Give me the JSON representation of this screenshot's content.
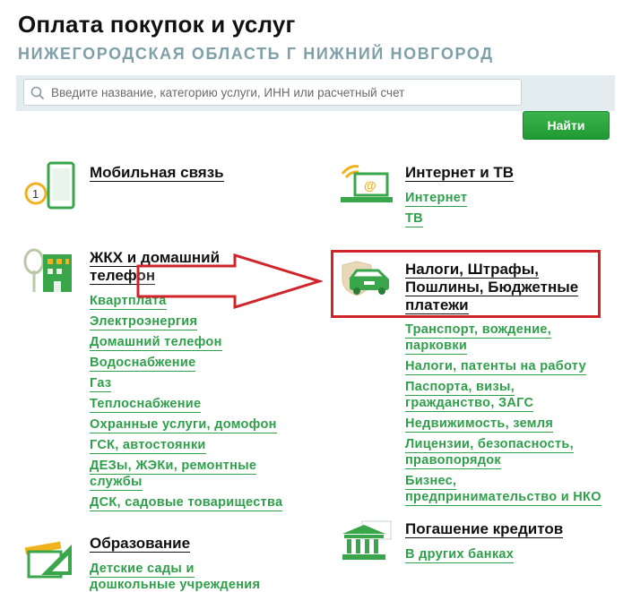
{
  "page": {
    "title": "Оплата покупок и услуг",
    "region": "НИЖЕГОРОДСКАЯ ОБЛАСТЬ Г НИЖНИЙ НОВГОРОД"
  },
  "search": {
    "placeholder": "Введите название, категорию услуги, ИНН или расчетный счет",
    "button_label": "Найти"
  },
  "categories": {
    "mobile": {
      "title": "Мобильная связь",
      "icon": "mobile-phone-icon"
    },
    "internet": {
      "title": "Интернет и ТВ",
      "icon": "laptop-icon",
      "links": [
        "Интернет",
        "ТВ"
      ]
    },
    "zhkh": {
      "title_line1": "ЖКХ и домашний",
      "title_line2": "телефон",
      "icon": "building-icon",
      "links": [
        "Квартплата",
        "Электроэнергия",
        "Домашний телефон",
        "Водоснабжение",
        "Газ",
        "Теплоснабжение",
        "Охранные услуги, домофон",
        "ГСК, автостоянки"
      ],
      "link_deza_line1": "ДЕЗы, ЖЭКи, ремонтные",
      "link_deza_line2": "службы",
      "link_dsk": "ДСК, садовые товарищества"
    },
    "taxes": {
      "title_line1": "Налоги, Штрафы,",
      "title_line2": "Пошлины, Бюджетные",
      "title_line3": "платежи",
      "icon": "car-shield-icon",
      "links": [
        [
          "Транспорт, вождение,",
          "парковки"
        ],
        [
          "Налоги, патенты на работу"
        ],
        [
          "Паспорта, визы,",
          "гражданство, ЗАГС"
        ],
        [
          "Недвижимость, земля"
        ],
        [
          "Лицензии, безопасность,",
          "правопорядок"
        ],
        [
          "Бизнес,",
          "предпринимательство и НКО"
        ]
      ]
    },
    "education": {
      "title": "Образование",
      "icon": "ruler-triangle-icon",
      "link_line1": "Детские сады и",
      "link_line2": "дошкольные учреждения"
    },
    "credits": {
      "title": "Погашение кредитов",
      "icon": "bank-icon",
      "links": [
        "В других банках"
      ]
    }
  },
  "colors": {
    "accent_green": "#2fa04a",
    "highlight_red": "#d0242b",
    "region_gray": "#7fa0a8"
  }
}
